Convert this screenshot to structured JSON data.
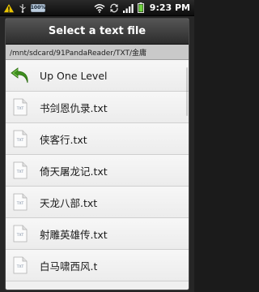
{
  "status_bar": {
    "battery_small": "100%",
    "time": "9:23 PM",
    "icons": [
      "warning-icon",
      "usb-icon",
      "battery-small-icon",
      "wifi-icon",
      "sync-icon",
      "signal-icon",
      "battery-icon"
    ]
  },
  "dialog": {
    "title": "Select a text file",
    "path": "/mnt/sdcard/91PandaReader/TXT/金庸",
    "up_label": "Up One Level",
    "files": [
      {
        "name": "书剑恩仇录.txt"
      },
      {
        "name": "侠客行.txt"
      },
      {
        "name": "倚天屠龙记.txt"
      },
      {
        "name": "天龙八部.txt"
      },
      {
        "name": "射雕英雄传.txt"
      },
      {
        "name": "白马啸西风.t"
      }
    ],
    "file_icon_text": "TXT"
  },
  "colors": {
    "up_arrow": "#3f8f1f",
    "title_bar": "#3a3a3a",
    "path_bar": "#c9c9c9"
  }
}
